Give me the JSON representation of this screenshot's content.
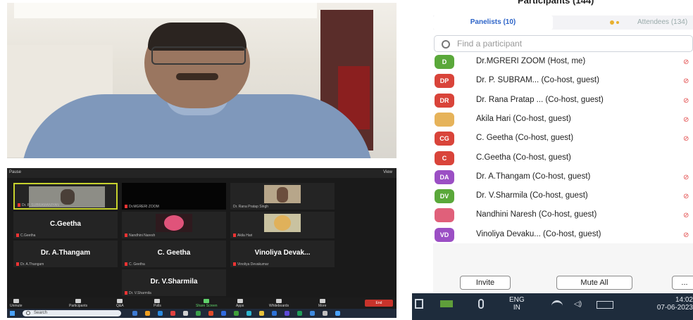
{
  "gallery": {
    "view_label": "Pause",
    "view_menu": "View",
    "tiles": [
      {
        "name": "",
        "label": "Dr. P. SUBRAMANIYAN"
      },
      {
        "name": "",
        "label": "Dr.MGRERI ZOOM"
      },
      {
        "name": "",
        "label": "Dr. Rana Pratap Singh"
      },
      {
        "name": "C.Geetha",
        "label": "C.Geetha"
      },
      {
        "name": "",
        "label": "Nandhini Naresh"
      },
      {
        "name": "",
        "label": "Akila Hari"
      },
      {
        "name": "Dr. A.Thangam",
        "label": "Dr. A.Thangam"
      },
      {
        "name": "C. Geetha",
        "label": "C. Geetha"
      },
      {
        "name": "Vinoliya  Devak...",
        "label": "Vinoliya Devakumar"
      },
      {
        "name": "Dr. V.Sharmila",
        "label": "Dr. V.Sharmila"
      }
    ],
    "toolbar": [
      "Unmute",
      "Participants",
      "Q&A",
      "Polls",
      "Share Screen",
      "Apps",
      "Whiteboards",
      "More"
    ],
    "end_label": "End",
    "search_label": "Search"
  },
  "panel": {
    "title": "Participants (144)",
    "tab_panelists": "Panelists (10)",
    "tab_attendees": "Attendees (134)",
    "search_placeholder": "Find a participant",
    "participants": [
      {
        "initials": "D",
        "color": "#5aa83a",
        "name": "Dr.MGRERI ZOOM (Host, me)"
      },
      {
        "initials": "DP",
        "color": "#d9443a",
        "name": "Dr. P. SUBRAM...   (Co-host, guest)"
      },
      {
        "initials": "DR",
        "color": "#d9443a",
        "name": "Dr. Rana Pratap ...   (Co-host, guest)"
      },
      {
        "initials": "",
        "color": "#e6b35a",
        "name": "Akila Hari (Co-host, guest)"
      },
      {
        "initials": "CG",
        "color": "#d9443a",
        "name": "C. Geetha (Co-host, guest)"
      },
      {
        "initials": "C",
        "color": "#d9443a",
        "name": "C.Geetha (Co-host, guest)"
      },
      {
        "initials": "DA",
        "color": "#9b4fc4",
        "name": "Dr. A.Thangam (Co-host, guest)"
      },
      {
        "initials": "DV",
        "color": "#5aa83a",
        "name": "Dr. V.Sharmila (Co-host, guest)"
      },
      {
        "initials": "",
        "color": "#e0607a",
        "name": "Nandhini Naresh (Co-host, guest)"
      },
      {
        "initials": "VD",
        "color": "#9b4fc4",
        "name": "Vinoliya Devaku...   (Co-host, guest)"
      }
    ],
    "invite_label": "Invite",
    "mute_all_label": "Mute All",
    "more_label": "..."
  },
  "taskbar": {
    "lang": "ENG",
    "lang2": "IN",
    "time": "14:02",
    "date": "07-06-2023"
  }
}
